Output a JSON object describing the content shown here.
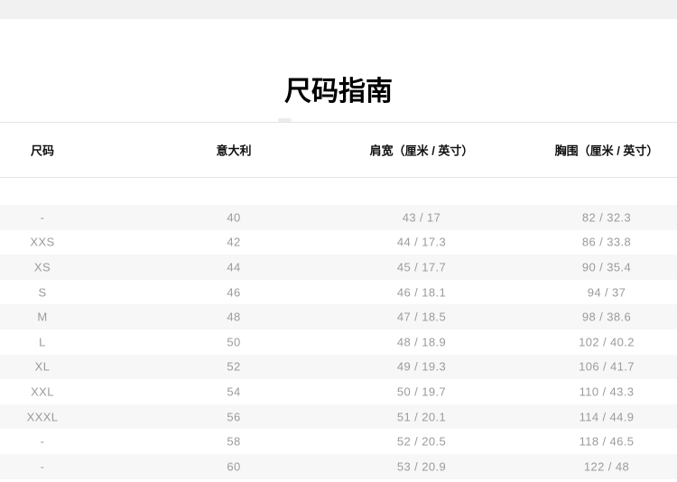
{
  "page": {
    "title": "尺码指南"
  },
  "table": {
    "columns": [
      {
        "key": "size",
        "label": "尺码"
      },
      {
        "key": "italy",
        "label": "意大利"
      },
      {
        "key": "shoulder",
        "label": "肩宽（厘米 / 英寸）"
      },
      {
        "key": "chest",
        "label": "胸围（厘米 / 英寸）"
      }
    ],
    "rows": [
      {
        "size": "-",
        "italy": "40",
        "shoulder": "43 / 17",
        "chest": "82 / 32.3"
      },
      {
        "size": "XXS",
        "italy": "42",
        "shoulder": "44 / 17.3",
        "chest": "86 / 33.8"
      },
      {
        "size": "XS",
        "italy": "44",
        "shoulder": "45 / 17.7",
        "chest": "90 / 35.4"
      },
      {
        "size": "S",
        "italy": "46",
        "shoulder": "46 / 18.1",
        "chest": "94 / 37"
      },
      {
        "size": "M",
        "italy": "48",
        "shoulder": "47 / 18.5",
        "chest": "98 / 38.6"
      },
      {
        "size": "L",
        "italy": "50",
        "shoulder": "48 / 18.9",
        "chest": "102 / 40.2"
      },
      {
        "size": "XL",
        "italy": "52",
        "shoulder": "49 / 19.3",
        "chest": "106 / 41.7"
      },
      {
        "size": "XXL",
        "italy": "54",
        "shoulder": "50 / 19.7",
        "chest": "110 / 43.3"
      },
      {
        "size": "XXXL",
        "italy": "56",
        "shoulder": "51 / 20.1",
        "chest": "114 / 44.9"
      },
      {
        "size": "-",
        "italy": "58",
        "shoulder": "52 / 20.5",
        "chest": "118 / 46.5"
      },
      {
        "size": "-",
        "italy": "60",
        "shoulder": "53 / 20.9",
        "chest": "122 / 48"
      }
    ]
  },
  "colors": {
    "top_bar": "#f1f1f1",
    "divider": "#e4e4e4",
    "row_stripe": "#f7f7f7",
    "data_text": "#9b9b9b",
    "header_text": "#111111",
    "title_text": "#000000"
  }
}
